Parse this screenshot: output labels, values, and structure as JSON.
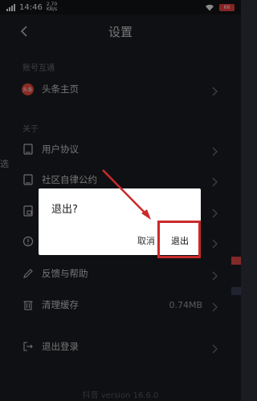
{
  "status_bar": {
    "time": "14:46",
    "network_speed": "2.70",
    "network_speed_unit": "KB/s",
    "battery": "66"
  },
  "header": {
    "title": "设置"
  },
  "sections": {
    "account_header": "账号互通",
    "about_header": "关于"
  },
  "rows": {
    "homepage": {
      "label": "头条主页",
      "icon": "toutiao-logo-icon",
      "avatar_text": "头条"
    },
    "user_agreement": {
      "label": "用户协议",
      "icon": "document-icon"
    },
    "community_convention": {
      "label": "社区自律公约",
      "icon": "document-icon"
    },
    "row_hidden_1": {
      "label": "",
      "icon": "lock-document-icon"
    },
    "row_hidden_2": {
      "label": "",
      "icon": "info-icon"
    },
    "feedback": {
      "label": "反馈与帮助",
      "icon": "pen-icon"
    },
    "clear_cache": {
      "label": "清理缓存",
      "icon": "trash-icon",
      "value": "0.74MB"
    },
    "logout": {
      "label": "退出登录",
      "icon": "logout-icon"
    }
  },
  "left_edge_text": "选",
  "footer": {
    "version_text": "抖音 version 16.6.0"
  },
  "dialog": {
    "title": "退出?",
    "cancel_label": "取消",
    "confirm_label": "退出"
  },
  "colors": {
    "background": "#1b1c22",
    "dialog_bg": "#ffffff",
    "annotation_red": "#c92a2a"
  }
}
